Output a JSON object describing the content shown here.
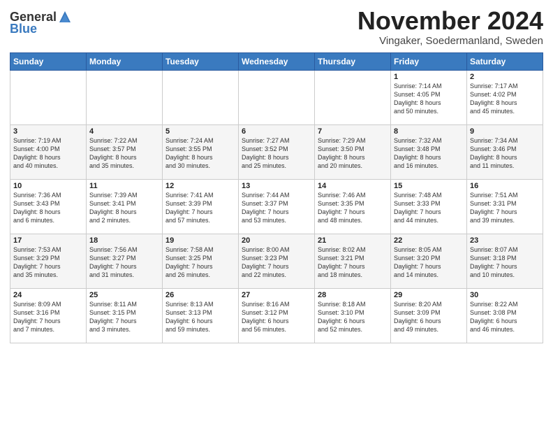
{
  "logo": {
    "general": "General",
    "blue": "Blue"
  },
  "title": "November 2024",
  "subtitle": "Vingaker, Soedermanland, Sweden",
  "headers": [
    "Sunday",
    "Monday",
    "Tuesday",
    "Wednesday",
    "Thursday",
    "Friday",
    "Saturday"
  ],
  "weeks": [
    [
      {
        "day": "",
        "info": ""
      },
      {
        "day": "",
        "info": ""
      },
      {
        "day": "",
        "info": ""
      },
      {
        "day": "",
        "info": ""
      },
      {
        "day": "",
        "info": ""
      },
      {
        "day": "1",
        "info": "Sunrise: 7:14 AM\nSunset: 4:05 PM\nDaylight: 8 hours\nand 50 minutes."
      },
      {
        "day": "2",
        "info": "Sunrise: 7:17 AM\nSunset: 4:02 PM\nDaylight: 8 hours\nand 45 minutes."
      }
    ],
    [
      {
        "day": "3",
        "info": "Sunrise: 7:19 AM\nSunset: 4:00 PM\nDaylight: 8 hours\nand 40 minutes."
      },
      {
        "day": "4",
        "info": "Sunrise: 7:22 AM\nSunset: 3:57 PM\nDaylight: 8 hours\nand 35 minutes."
      },
      {
        "day": "5",
        "info": "Sunrise: 7:24 AM\nSunset: 3:55 PM\nDaylight: 8 hours\nand 30 minutes."
      },
      {
        "day": "6",
        "info": "Sunrise: 7:27 AM\nSunset: 3:52 PM\nDaylight: 8 hours\nand 25 minutes."
      },
      {
        "day": "7",
        "info": "Sunrise: 7:29 AM\nSunset: 3:50 PM\nDaylight: 8 hours\nand 20 minutes."
      },
      {
        "day": "8",
        "info": "Sunrise: 7:32 AM\nSunset: 3:48 PM\nDaylight: 8 hours\nand 16 minutes."
      },
      {
        "day": "9",
        "info": "Sunrise: 7:34 AM\nSunset: 3:46 PM\nDaylight: 8 hours\nand 11 minutes."
      }
    ],
    [
      {
        "day": "10",
        "info": "Sunrise: 7:36 AM\nSunset: 3:43 PM\nDaylight: 8 hours\nand 6 minutes."
      },
      {
        "day": "11",
        "info": "Sunrise: 7:39 AM\nSunset: 3:41 PM\nDaylight: 8 hours\nand 2 minutes."
      },
      {
        "day": "12",
        "info": "Sunrise: 7:41 AM\nSunset: 3:39 PM\nDaylight: 7 hours\nand 57 minutes."
      },
      {
        "day": "13",
        "info": "Sunrise: 7:44 AM\nSunset: 3:37 PM\nDaylight: 7 hours\nand 53 minutes."
      },
      {
        "day": "14",
        "info": "Sunrise: 7:46 AM\nSunset: 3:35 PM\nDaylight: 7 hours\nand 48 minutes."
      },
      {
        "day": "15",
        "info": "Sunrise: 7:48 AM\nSunset: 3:33 PM\nDaylight: 7 hours\nand 44 minutes."
      },
      {
        "day": "16",
        "info": "Sunrise: 7:51 AM\nSunset: 3:31 PM\nDaylight: 7 hours\nand 39 minutes."
      }
    ],
    [
      {
        "day": "17",
        "info": "Sunrise: 7:53 AM\nSunset: 3:29 PM\nDaylight: 7 hours\nand 35 minutes."
      },
      {
        "day": "18",
        "info": "Sunrise: 7:56 AM\nSunset: 3:27 PM\nDaylight: 7 hours\nand 31 minutes."
      },
      {
        "day": "19",
        "info": "Sunrise: 7:58 AM\nSunset: 3:25 PM\nDaylight: 7 hours\nand 26 minutes."
      },
      {
        "day": "20",
        "info": "Sunrise: 8:00 AM\nSunset: 3:23 PM\nDaylight: 7 hours\nand 22 minutes."
      },
      {
        "day": "21",
        "info": "Sunrise: 8:02 AM\nSunset: 3:21 PM\nDaylight: 7 hours\nand 18 minutes."
      },
      {
        "day": "22",
        "info": "Sunrise: 8:05 AM\nSunset: 3:20 PM\nDaylight: 7 hours\nand 14 minutes."
      },
      {
        "day": "23",
        "info": "Sunrise: 8:07 AM\nSunset: 3:18 PM\nDaylight: 7 hours\nand 10 minutes."
      }
    ],
    [
      {
        "day": "24",
        "info": "Sunrise: 8:09 AM\nSunset: 3:16 PM\nDaylight: 7 hours\nand 7 minutes."
      },
      {
        "day": "25",
        "info": "Sunrise: 8:11 AM\nSunset: 3:15 PM\nDaylight: 7 hours\nand 3 minutes."
      },
      {
        "day": "26",
        "info": "Sunrise: 8:13 AM\nSunset: 3:13 PM\nDaylight: 6 hours\nand 59 minutes."
      },
      {
        "day": "27",
        "info": "Sunrise: 8:16 AM\nSunset: 3:12 PM\nDaylight: 6 hours\nand 56 minutes."
      },
      {
        "day": "28",
        "info": "Sunrise: 8:18 AM\nSunset: 3:10 PM\nDaylight: 6 hours\nand 52 minutes."
      },
      {
        "day": "29",
        "info": "Sunrise: 8:20 AM\nSunset: 3:09 PM\nDaylight: 6 hours\nand 49 minutes."
      },
      {
        "day": "30",
        "info": "Sunrise: 8:22 AM\nSunset: 3:08 PM\nDaylight: 6 hours\nand 46 minutes."
      }
    ]
  ]
}
